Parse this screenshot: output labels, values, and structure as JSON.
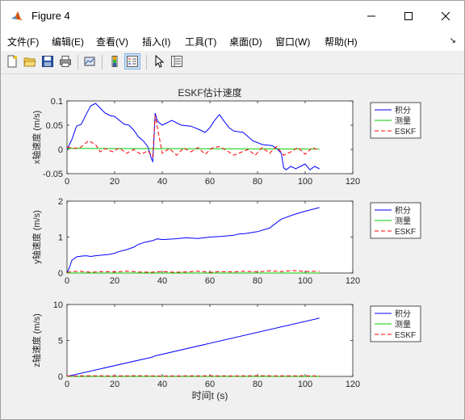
{
  "window": {
    "title": "Figure 4"
  },
  "menu": {
    "items": [
      "文件(F)",
      "编辑(E)",
      "查看(V)",
      "插入(I)",
      "工具(T)",
      "桌面(D)",
      "窗口(W)",
      "帮助(H)"
    ]
  },
  "toolbar": {
    "buttons": [
      "new-figure",
      "open-file",
      "save",
      "print",
      "link-plot",
      "insert-colorbar",
      "insert-legend",
      "edit-plot",
      "open-property-inspector"
    ]
  },
  "colors": {
    "integral": "#0000ff",
    "measure": "#00cc00",
    "eskf": "#ff0000"
  },
  "chart_data": [
    {
      "type": "line",
      "title": "ESKF估计速度",
      "xlabel": "",
      "ylabel": "x轴速度 (m/s)",
      "xlim": [
        0,
        120
      ],
      "ylim": [
        -0.05,
        0.1
      ],
      "xticks": [
        "0",
        "20",
        "40",
        "60",
        "80",
        "100",
        "120"
      ],
      "yticks": [
        "-0.05",
        "0",
        "0.05",
        "0.1"
      ],
      "ytick_values": [
        -0.05,
        0,
        0.05,
        0.1
      ],
      "legend": [
        "积分",
        "测量",
        "ESKF"
      ],
      "legend_position": "outside-right",
      "series": [
        {
          "name": "积分",
          "style": "solid",
          "x": [
            0,
            2,
            4,
            6,
            8,
            10,
            12,
            14,
            16,
            18,
            20,
            22,
            24,
            26,
            28,
            30,
            32,
            34,
            35.5,
            36,
            36.5,
            37,
            38,
            40,
            44,
            48,
            52,
            56,
            58,
            60,
            62,
            64,
            66,
            68,
            70,
            74,
            78,
            82,
            86,
            88,
            90,
            91,
            92,
            94,
            96,
            98,
            100,
            102,
            104,
            106
          ],
          "y": [
            0,
            0.02,
            0.048,
            0.052,
            0.072,
            0.09,
            0.095,
            0.085,
            0.075,
            0.07,
            0.068,
            0.06,
            0.052,
            0.05,
            0.04,
            0.026,
            0.018,
            0.005,
            -0.02,
            -0.025,
            0.02,
            0.075,
            0.058,
            0.05,
            0.06,
            0.05,
            0.048,
            0.04,
            0.035,
            0.045,
            0.06,
            0.072,
            0.058,
            0.045,
            0.038,
            0.035,
            0.018,
            0.01,
            0.008,
            0.002,
            -0.008,
            -0.038,
            -0.042,
            -0.035,
            -0.04,
            -0.035,
            -0.03,
            -0.042,
            -0.035,
            -0.04
          ]
        },
        {
          "name": "测量",
          "style": "solid",
          "x": [
            0,
            106
          ],
          "y": [
            0.002,
            0.001
          ]
        },
        {
          "name": "ESKF",
          "style": "dashed",
          "x": [
            0,
            3,
            6,
            9,
            12,
            14,
            16,
            19,
            22,
            25,
            28,
            31,
            34,
            36,
            37,
            40,
            43,
            46,
            49,
            52,
            55,
            58,
            61,
            64,
            67,
            70,
            73,
            76,
            79,
            82,
            85,
            88,
            91,
            94,
            97,
            100,
            103,
            106
          ],
          "y": [
            0.005,
            0.002,
            0.005,
            0.018,
            0.01,
            -0.005,
            0.002,
            -0.005,
            0.003,
            -0.008,
            0.0,
            -0.01,
            -0.003,
            -0.015,
            0.07,
            -0.008,
            0.002,
            -0.012,
            0.003,
            -0.005,
            0.004,
            -0.01,
            0.003,
            0.006,
            -0.002,
            -0.012,
            -0.006,
            0.0,
            -0.012,
            0.004,
            -0.008,
            0.006,
            -0.012,
            -0.005,
            0.004,
            -0.01,
            0.004,
            -0.002
          ]
        }
      ]
    },
    {
      "type": "line",
      "title": "",
      "xlabel": "",
      "ylabel": "y轴速度 (m/s)",
      "xlim": [
        0,
        120
      ],
      "ylim": [
        0,
        2
      ],
      "xticks": [
        "0",
        "20",
        "40",
        "60",
        "80",
        "100",
        "120"
      ],
      "yticks": [
        "0",
        "1",
        "2"
      ],
      "ytick_values": [
        0,
        1,
        2
      ],
      "legend": [
        "积分",
        "测量",
        "ESKF"
      ],
      "legend_position": "outside-right",
      "series": [
        {
          "name": "积分",
          "style": "solid",
          "x": [
            0,
            1,
            2,
            4,
            6,
            8,
            10,
            12,
            15,
            18,
            20,
            22,
            25,
            28,
            30,
            33,
            36,
            38,
            40,
            45,
            50,
            55,
            60,
            65,
            70,
            72,
            75,
            80,
            85,
            88,
            90,
            95,
            100,
            106
          ],
          "y": [
            0,
            0.15,
            0.35,
            0.45,
            0.47,
            0.48,
            0.46,
            0.48,
            0.5,
            0.52,
            0.55,
            0.6,
            0.65,
            0.72,
            0.8,
            0.86,
            0.9,
            0.95,
            0.93,
            0.95,
            0.98,
            0.96,
            1.0,
            1.02,
            1.05,
            1.08,
            1.1,
            1.15,
            1.25,
            1.4,
            1.5,
            1.62,
            1.72,
            1.82
          ]
        },
        {
          "name": "测量",
          "style": "solid",
          "x": [
            0,
            106
          ],
          "y": [
            0.0,
            0.0
          ]
        },
        {
          "name": "ESKF",
          "style": "dashed",
          "x": [
            0,
            5,
            10,
            15,
            20,
            25,
            30,
            35,
            40,
            45,
            50,
            55,
            60,
            65,
            70,
            75,
            80,
            85,
            90,
            95,
            100,
            106
          ],
          "y": [
            0.02,
            0.05,
            0.02,
            0.04,
            0.03,
            0.05,
            0.03,
            0.02,
            0.04,
            0.02,
            0.03,
            0.05,
            0.02,
            0.04,
            0.03,
            0.05,
            0.03,
            0.06,
            0.04,
            0.07,
            0.04,
            0.05
          ]
        }
      ]
    },
    {
      "type": "line",
      "title": "",
      "xlabel": "时间t (s)",
      "ylabel": "z轴速度 (m/s)",
      "xlim": [
        0,
        120
      ],
      "ylim": [
        0,
        10
      ],
      "xticks": [
        "0",
        "20",
        "40",
        "60",
        "80",
        "100",
        "120"
      ],
      "yticks": [
        "0",
        "5",
        "10"
      ],
      "ytick_values": [
        0,
        5,
        10
      ],
      "legend": [
        "积分",
        "测量",
        "ESKF"
      ],
      "legend_position": "outside-right",
      "series": [
        {
          "name": "积分",
          "style": "solid",
          "x": [
            0,
            36,
            37,
            106
          ],
          "y": [
            0,
            2.7,
            2.85,
            8.1
          ]
        },
        {
          "name": "测量",
          "style": "solid",
          "x": [
            0,
            106
          ],
          "y": [
            0.0,
            0.0
          ]
        },
        {
          "name": "ESKF",
          "style": "dashed",
          "x": [
            0,
            10,
            20,
            30,
            40,
            50,
            60,
            70,
            80,
            90,
            100,
            106
          ],
          "y": [
            0.05,
            0.08,
            0.06,
            0.09,
            0.05,
            0.07,
            0.08,
            0.06,
            0.09,
            0.07,
            0.08,
            0.06
          ]
        }
      ]
    }
  ]
}
